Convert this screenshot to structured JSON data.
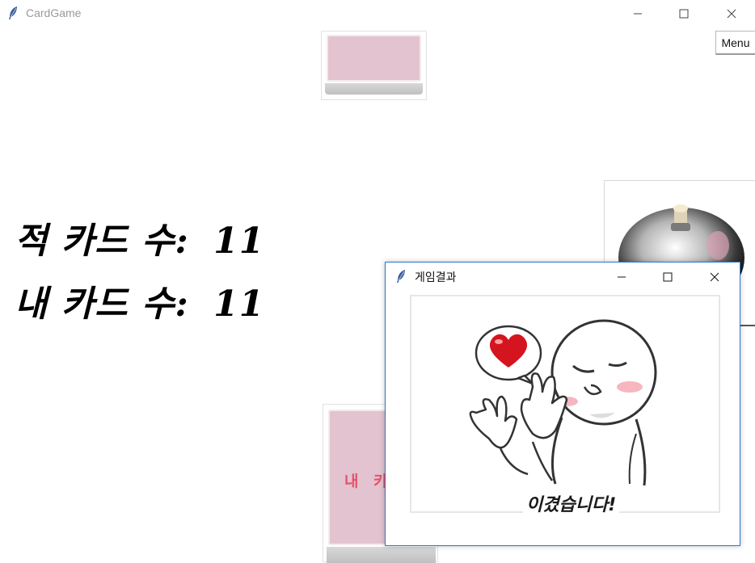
{
  "window": {
    "title": "CardGame",
    "icon": "feather-icon"
  },
  "menu": {
    "label": "Menu"
  },
  "counts": {
    "enemy_label": "적 카드 수:",
    "enemy_value": "11",
    "my_label": "내 카드 수:",
    "my_value": "11"
  },
  "my_card": {
    "text": "내 카"
  },
  "popup": {
    "title": "게임결과",
    "result_text": "이겼습니다!",
    "icon": "feather-icon"
  },
  "colors": {
    "card_back": "#e2c3cf",
    "card_text": "#e8506a",
    "popup_border": "#2b79c9",
    "heart": "#d4141e"
  }
}
